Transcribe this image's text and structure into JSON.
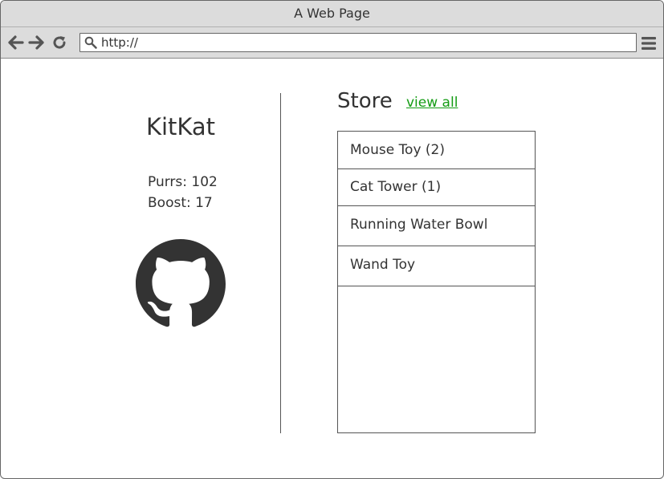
{
  "window": {
    "title": "A Web Page"
  },
  "toolbar": {
    "back_icon": "arrow-left-icon",
    "forward_icon": "arrow-right-icon",
    "reload_icon": "reload-icon",
    "menu_icon": "hamburger-menu-icon",
    "address": {
      "value": "http://",
      "icon": "search-icon"
    }
  },
  "profile": {
    "name": "KitKat",
    "purrs_label": "Purrs: 102",
    "boost_label": "Boost: 17",
    "avatar_icon": "github-octocat-icon"
  },
  "store": {
    "title": "Store",
    "view_all_label": "view all",
    "items": [
      {
        "label": "Mouse Toy (2)"
      },
      {
        "label": "Cat Tower (1)"
      },
      {
        "label": "Running Water Bowl"
      },
      {
        "label": "Wand Toy"
      }
    ]
  },
  "colors": {
    "chrome": "#dcdcdc",
    "text": "#333333",
    "link": "#139c13",
    "border": "#555555"
  }
}
